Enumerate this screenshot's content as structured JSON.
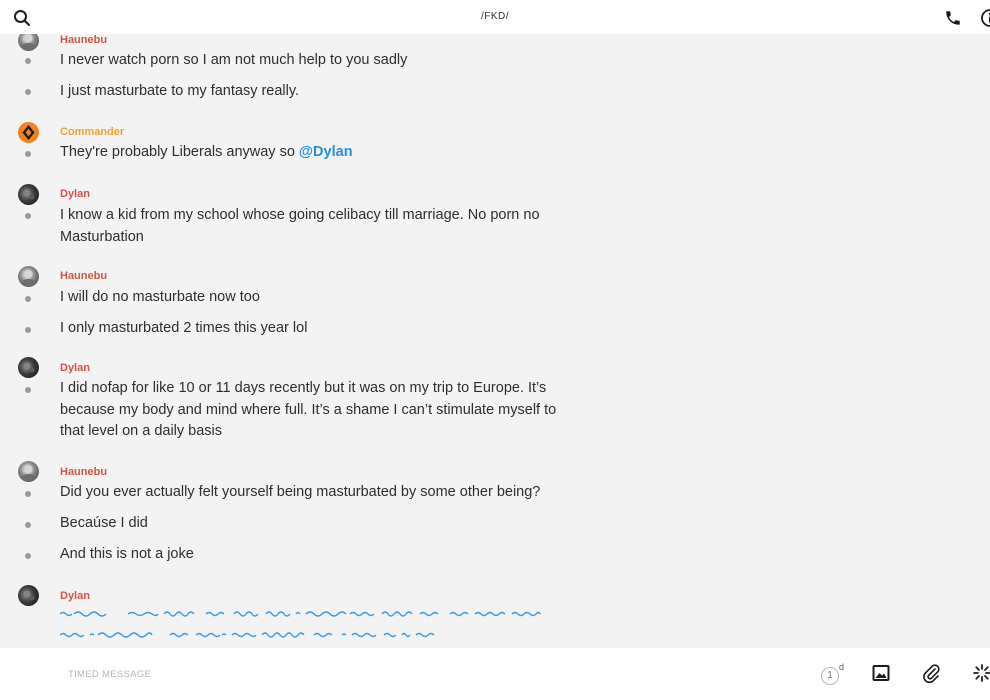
{
  "header": {
    "title": "/FKD/"
  },
  "messages": [
    {
      "author": "Haunebu",
      "text": "I never watch porn so I am not much help to you sadly"
    },
    {
      "text": "I just masturbate to my fantasy really."
    },
    {
      "author": "Commander",
      "text_before": "They're probably Liberals anyway so ",
      "mention": "@Dylan"
    },
    {
      "author": "Dylan",
      "text": "I know a kid from my school whose going celibacy till marriage. No porn no Masturbation"
    },
    {
      "author": "Haunebu",
      "text": "I will do no masturbate now too"
    },
    {
      "text": "I only masturbated 2 times this year lol"
    },
    {
      "author": "Dylan",
      "text": "I did nofap for like 10 or 11 days recently but it was on my trip to Europe. It’s because my body and mind where full. It’s a shame I can’t stimulate myself to that level on a daily basis"
    },
    {
      "author": "Haunebu",
      "text": "Did you ever actually felt yourself being masturbated by some other being?"
    },
    {
      "text": "Becaúse I did"
    },
    {
      "text": "And this is not a joke"
    },
    {
      "author": "Dylan"
    }
  ],
  "composer": {
    "placeholder": "TIMED MESSAGE",
    "timer_value": "1",
    "timer_unit": "d"
  },
  "colors": {
    "author_red": "#d8514b",
    "author_orange": "#efa133",
    "mention_blue": "#2a8fd6",
    "scribble_blue": "#3d9bd8"
  },
  "icons": [
    "search-icon",
    "phone-icon",
    "info-icon",
    "timer-icon",
    "image-icon",
    "paperclip-icon",
    "spinner-icon"
  ]
}
